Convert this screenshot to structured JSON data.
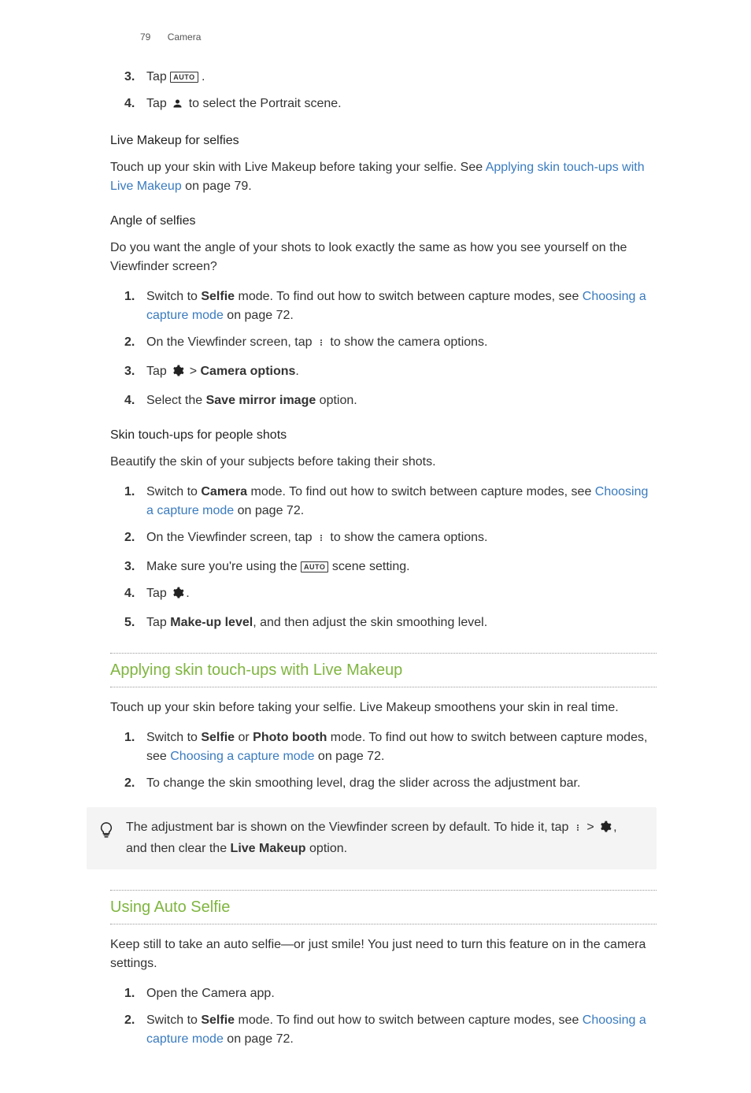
{
  "header": {
    "page_number": "79",
    "section": "Camera"
  },
  "intro_steps": {
    "s3": {
      "pre": "Tap ",
      "post": "."
    },
    "s4": {
      "pre": "Tap ",
      "post": " to select the Portrait scene."
    }
  },
  "live_makeup_selfies": {
    "heading": "Live Makeup for selfies",
    "text_pre": "Touch up your skin with Live Makeup before taking your selfie. See ",
    "link": "Applying skin touch-ups with Live Makeup",
    "text_post": " on page 79."
  },
  "angle_selfies": {
    "heading": "Angle of selfies",
    "intro": "Do you want the angle of your shots to look exactly the same as how you see yourself on the Viewfinder screen?",
    "s1": {
      "pre": "Switch to ",
      "bold": "Selfie",
      "mid": " mode. To find out how to switch between capture modes, see ",
      "link": "Choosing a capture mode",
      "post": " on page 72."
    },
    "s2": {
      "pre": "On the Viewfinder screen, tap ",
      "post": " to show the camera options."
    },
    "s3": {
      "pre": "Tap ",
      "mid": " > ",
      "bold": "Camera options",
      "post": "."
    },
    "s4": {
      "pre": "Select the ",
      "bold": "Save mirror image",
      "post": " option."
    }
  },
  "skin_touchups": {
    "heading": "Skin touch-ups for people shots",
    "intro": "Beautify the skin of your subjects before taking their shots.",
    "s1": {
      "pre": "Switch to ",
      "bold": "Camera",
      "mid": " mode. To find out how to switch between capture modes, see ",
      "link": "Choosing a capture mode",
      "post": " on page 72."
    },
    "s2": {
      "pre": "On the Viewfinder screen, tap ",
      "post": " to show the camera options."
    },
    "s3": {
      "pre": "Make sure you're using the ",
      "post": " scene setting."
    },
    "s4": {
      "pre": "Tap ",
      "post": "."
    },
    "s5": {
      "pre": "Tap ",
      "bold": "Make-up level",
      "post": ", and then adjust the skin smoothing level."
    }
  },
  "applying": {
    "heading": "Applying skin touch-ups with Live Makeup",
    "intro": "Touch up your skin before taking your selfie. Live Makeup smoothens your skin in real time.",
    "s1": {
      "pre": "Switch to ",
      "bold1": "Selfie",
      "mid1": " or ",
      "bold2": "Photo booth",
      "mid2": " mode. To find out how to switch between capture modes, see ",
      "link": "Choosing a capture mode",
      "post": " on page 72."
    },
    "s2": {
      "text": "To change the skin smoothing level, drag the slider across the adjustment bar."
    },
    "tip": {
      "pre": "The adjustment bar is shown on the Viewfinder screen by default. To hide it, tap ",
      "mid1": " > ",
      "mid2": ", and then clear the ",
      "bold": "Live Makeup",
      "post": " option."
    }
  },
  "auto_selfie": {
    "heading": "Using Auto Selfie",
    "intro": "Keep still to take an auto selfie—or just smile! You just need to turn this feature on in the camera settings.",
    "s1": {
      "text": "Open the Camera app."
    },
    "s2": {
      "pre": "Switch to ",
      "bold": "Selfie",
      "mid": " mode. To find out how to switch between capture modes, see ",
      "link": "Choosing a capture mode",
      "post": " on page 72."
    }
  },
  "icons": {
    "auto_label": "AUTO"
  }
}
